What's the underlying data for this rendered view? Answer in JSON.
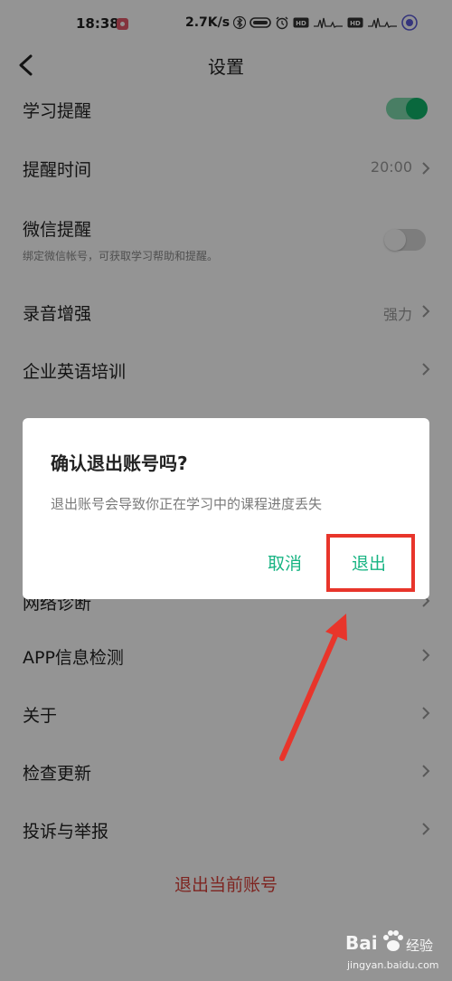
{
  "status_bar": {
    "time": "18:38",
    "network_speed": "2.7K/s",
    "icons": [
      "bluetooth-icon",
      "wifi-icon",
      "alarm-icon",
      "hd-icon",
      "signal-5g-icon",
      "hd-icon",
      "signal-4g-icon",
      "battery-icon"
    ]
  },
  "header": {
    "title": "设置",
    "back_icon": "chevron-left-icon"
  },
  "settings": {
    "study_reminder": {
      "label": "学习提醒",
      "enabled": true
    },
    "reminder_time": {
      "label": "提醒时间",
      "value": "20:00"
    },
    "wechat_reminder": {
      "label": "微信提醒",
      "subtitle": "绑定微信帐号，可获取学习帮助和提醒。",
      "enabled": false
    },
    "recording_enhance": {
      "label": "录音增强",
      "value": "强力"
    },
    "enterprise_training": {
      "label": "企业英语培训"
    },
    "network_diagnosis": {
      "label": "网络诊断"
    },
    "app_info_check": {
      "label": "APP信息检测"
    },
    "about": {
      "label": "关于"
    },
    "check_update": {
      "label": "检查更新"
    },
    "complaint_report": {
      "label": "投诉与举报"
    },
    "logout": {
      "label": "退出当前账号"
    }
  },
  "dialog": {
    "title": "确认退出账号吗?",
    "message": "退出账号会导致你正在学习中的课程进度丢失",
    "cancel_label": "取消",
    "confirm_label": "退出"
  },
  "watermark": {
    "brand": "Bai",
    "text": "经验",
    "domain": "jingyan.baidu.com"
  },
  "colors": {
    "accent_green": "#11b36a",
    "dialog_button": "#18b483",
    "logout_red": "#d9413a",
    "annotation_red": "#e8352b"
  }
}
